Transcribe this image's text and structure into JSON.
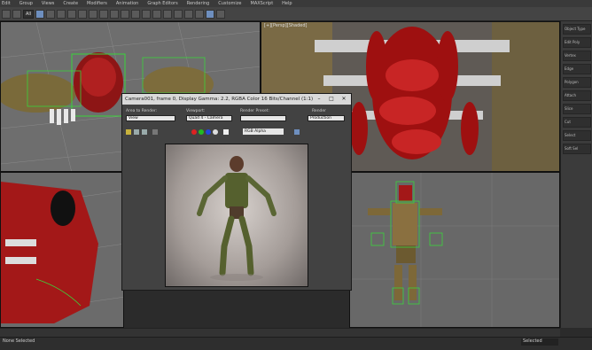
{
  "menu": [
    "Edit",
    "Group",
    "Views",
    "Create",
    "Modifiers",
    "Animation",
    "Graph Editors",
    "Rendering",
    "Customize",
    "MAXScript",
    "Help"
  ],
  "toolbar": {
    "selection_filter": "All"
  },
  "viewports": {
    "top_right_label": "[+][Persp][Shaded]",
    "bottom_right_label": "",
    "top_left_label": "",
    "bottom_left_label": ""
  },
  "frame_window": {
    "title": "Camera001, frame 0, Display Gamma: 2.2, RGBA Color 16 Bits/Channel (1:1)",
    "area_to_render_label": "Area to Render:",
    "area_to_render_value": "View",
    "viewport_label": "Viewport:",
    "viewport_value": "Quad 4 - Camera",
    "render_preset_label": "Render Preset:",
    "render_preset_value": "",
    "renderer_label": "Render",
    "renderer_value": "Production",
    "channel_value": "RGB Alpha",
    "close_glyph": "✕",
    "min_glyph": "–",
    "max_glyph": "□"
  },
  "command_panel": {
    "items": [
      "Object Type",
      "Edit Poly",
      "Vertex",
      "Edge",
      "Polygon",
      "Attach",
      "Slice",
      "Cut",
      "Select",
      "Soft Sel"
    ]
  },
  "statusbar": {
    "selection_text": "None Selected",
    "selected_value": "Selected"
  }
}
